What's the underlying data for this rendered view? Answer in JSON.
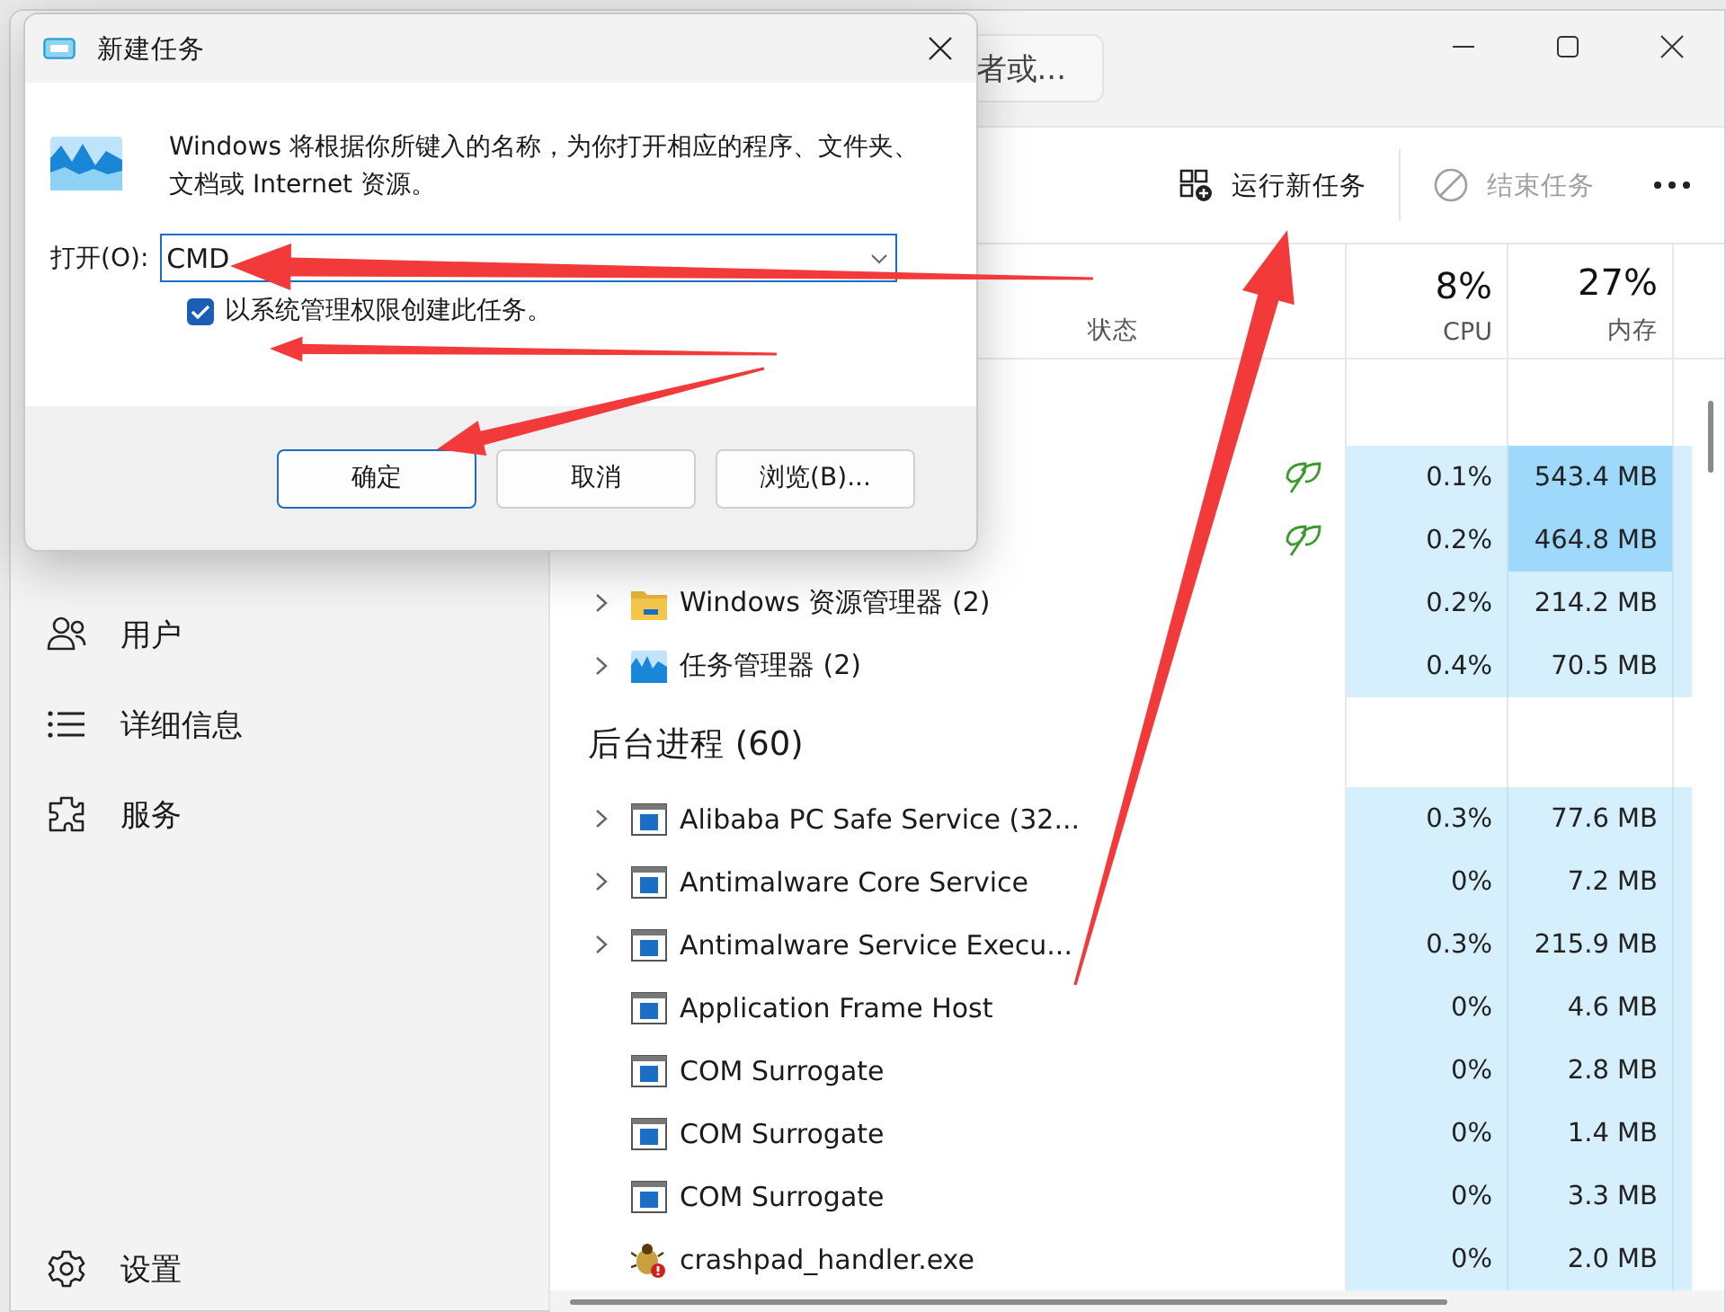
{
  "task_manager": {
    "search": {
      "placeholder": "者或..."
    },
    "sidebar": {
      "items": [
        {
          "label": "用户"
        },
        {
          "label": "详细信息"
        },
        {
          "label": "服务"
        }
      ],
      "settings": "设置"
    },
    "toolbar": {
      "run_new_task": "运行新任务",
      "end_task": {
        "label": "结束任务",
        "disabled": true
      }
    },
    "columns": {
      "status": "状态",
      "cpu": {
        "total": "8%",
        "label": "CPU"
      },
      "memory": {
        "total": "27%",
        "label": "内存"
      }
    },
    "rows": [
      {
        "kind": "hidden",
        "eco": true,
        "cpu": "0.1%",
        "memory": "543.4 MB",
        "memory_high": true
      },
      {
        "kind": "hidden",
        "eco": true,
        "cpu": "0.2%",
        "memory": "464.8 MB",
        "memory_high": true
      },
      {
        "kind": "folder",
        "name": "Windows 资源管理器 (2)",
        "expandable": true,
        "eco": false,
        "cpu": "0.2%",
        "memory": "214.2 MB",
        "memory_high": false
      },
      {
        "kind": "monitor",
        "name": "任务管理器 (2)",
        "expandable": true,
        "eco": false,
        "cpu": "0.4%",
        "memory": "70.5 MB",
        "memory_high": false
      },
      {
        "kind": "section",
        "name": "后台进程 (60)"
      },
      {
        "kind": "window",
        "name": "Alibaba PC Safe Service (32...",
        "expandable": true,
        "eco": false,
        "cpu": "0.3%",
        "memory": "77.6 MB",
        "memory_high": false
      },
      {
        "kind": "window",
        "name": "Antimalware Core Service",
        "expandable": true,
        "eco": false,
        "cpu": "0%",
        "memory": "7.2 MB",
        "memory_high": false
      },
      {
        "kind": "window",
        "name": "Antimalware Service Execu...",
        "expandable": true,
        "eco": false,
        "cpu": "0.3%",
        "memory": "215.9 MB",
        "memory_high": false
      },
      {
        "kind": "window",
        "name": "Application Frame Host",
        "expandable": false,
        "eco": false,
        "cpu": "0%",
        "memory": "4.6 MB",
        "memory_high": false
      },
      {
        "kind": "window",
        "name": "COM Surrogate",
        "expandable": false,
        "eco": false,
        "cpu": "0%",
        "memory": "2.8 MB",
        "memory_high": false
      },
      {
        "kind": "window",
        "name": "COM Surrogate",
        "expandable": false,
        "eco": false,
        "cpu": "0%",
        "memory": "1.4 MB",
        "memory_high": false
      },
      {
        "kind": "window",
        "name": "COM Surrogate",
        "expandable": false,
        "eco": false,
        "cpu": "0%",
        "memory": "3.3 MB",
        "memory_high": false
      },
      {
        "kind": "bug",
        "name": "crashpad_handler.exe",
        "expandable": false,
        "eco": false,
        "cpu": "0%",
        "memory": "2.0 MB",
        "memory_high": false
      }
    ]
  },
  "dialog": {
    "title": "新建任务",
    "description": "Windows 将根据你所键入的名称，为你打开相应的程序、文件夹、文档或 Internet 资源。",
    "open_label": "打开(O):",
    "open_value": "CMD",
    "admin": {
      "label": "以系统管理权限创建此任务。",
      "checked": true
    },
    "buttons": [
      {
        "label": "确定",
        "default": true
      },
      {
        "label": "取消",
        "default": false
      },
      {
        "label": "浏览(B)...",
        "default": false
      }
    ]
  },
  "annotations": [
    {
      "kind": "arrow"
    },
    {
      "kind": "arrow"
    },
    {
      "kind": "arrow"
    },
    {
      "kind": "arrow"
    }
  ]
}
